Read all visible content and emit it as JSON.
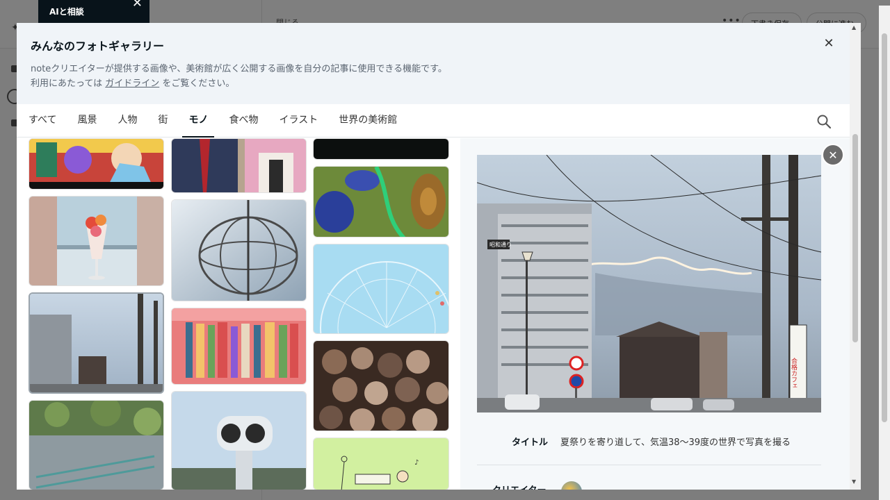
{
  "background": {
    "close_label": "閉じる",
    "draft_label": "下書き保存",
    "publish_label": "公開に進む"
  },
  "ai_tooltip": {
    "label": "AIと相談"
  },
  "modal": {
    "title": "みんなのフォトギャラリー",
    "description_line1": "noteクリエイターが提供する画像や、美術館が広く公開する画像を自分の記事に使用できる機能です。",
    "description_prefix": "利用にあたっては ",
    "guideline_link": "ガイドライン",
    "description_suffix": " をご覧ください。",
    "close_icon": "close-icon"
  },
  "tabs": [
    {
      "label": "すべて",
      "active": false
    },
    {
      "label": "風景",
      "active": false
    },
    {
      "label": "人物",
      "active": false
    },
    {
      "label": "街",
      "active": false
    },
    {
      "label": "モノ",
      "active": true
    },
    {
      "label": "食べ物",
      "active": false
    },
    {
      "label": "イラスト",
      "active": false
    },
    {
      "label": "世界の美術館",
      "active": false
    }
  ],
  "gallery": {
    "tiles": [
      {
        "name": "tile-anime-kimono"
      },
      {
        "name": "tile-parfait"
      },
      {
        "name": "tile-street-selected"
      },
      {
        "name": "tile-plants-fence"
      },
      {
        "name": "tile-anime-office"
      },
      {
        "name": "tile-sphere-sculpture"
      },
      {
        "name": "tile-books"
      },
      {
        "name": "tile-binoculars"
      },
      {
        "name": "tile-dark"
      },
      {
        "name": "tile-green-abstract"
      },
      {
        "name": "tile-ferris-wheel"
      },
      {
        "name": "tile-metal-texture"
      },
      {
        "name": "tile-green-illustration"
      }
    ]
  },
  "detail": {
    "title_label": "タイトル",
    "title_value": "夏祭りを寄り道して、気温38〜39度の世界で写真を撮る",
    "creator_label": "クリエイター",
    "sign_text": "昭和通り",
    "cafe_sign": "合格カフェ"
  },
  "colors": {
    "accent": "#08131a",
    "overlay": "#7d7d7d",
    "header_bg": "#f0f4f8"
  }
}
